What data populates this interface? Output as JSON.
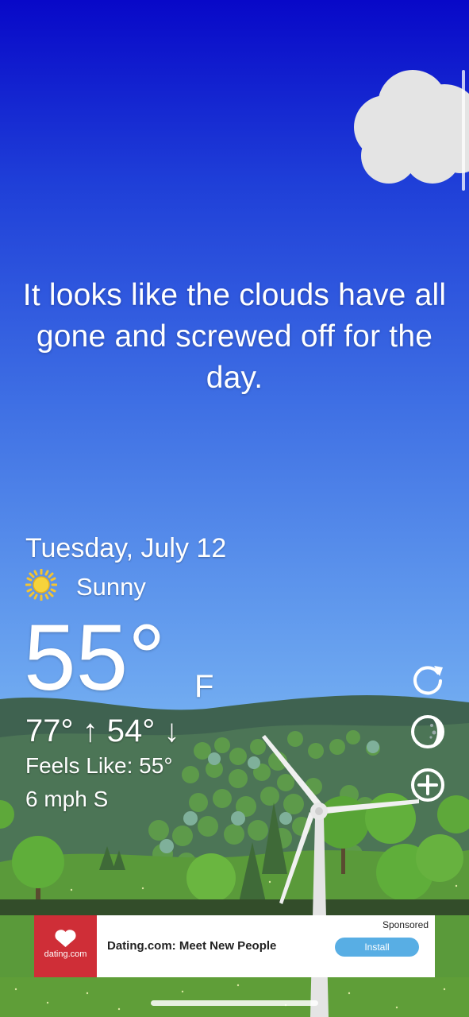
{
  "message": "It looks like the clouds have all gone and screwed off for the day.",
  "current": {
    "date": "Tuesday, July 12",
    "condition": "Sunny",
    "condition_icon": "sun-icon",
    "temperature": "55°",
    "unit": "F",
    "high_low": "77° ↑  54° ↓",
    "feels_like": "Feels Like: 55°",
    "wind": "6 mph S"
  },
  "controls": [
    "refresh-icon",
    "moon-phase-icon",
    "add-location-icon"
  ],
  "ad": {
    "sponsored_label": "Sponsored",
    "logo_text": "dating.com",
    "title": "Dating.com: Meet New People",
    "cta": "Install"
  }
}
